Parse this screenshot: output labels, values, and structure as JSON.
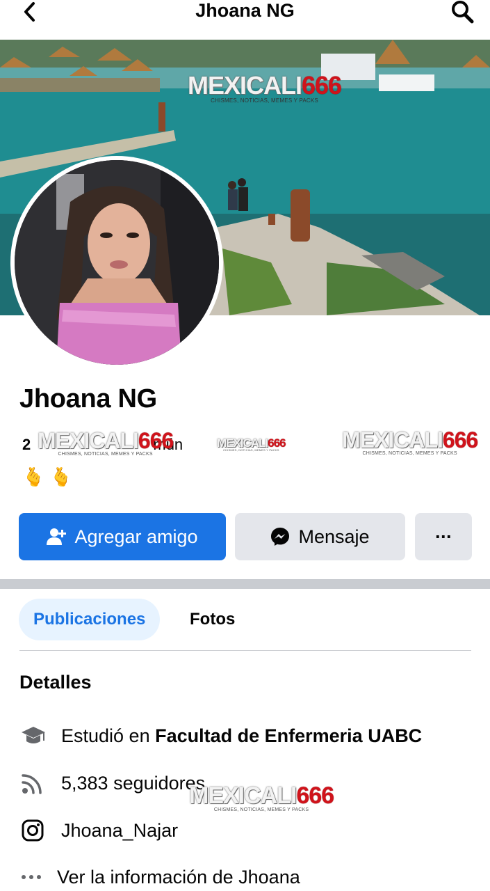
{
  "header": {
    "title": "Jhoana NG",
    "back_icon": "chevron-left-icon",
    "search_icon": "search-icon"
  },
  "watermark": {
    "brand_main": "MEXICALI",
    "brand_num": "666",
    "tagline": "CHISMES, NOTICIAS, MEMES Y PACKS"
  },
  "profile": {
    "name": "Jhoana NG",
    "mutual_prefix": "2",
    "mutual_suffix": "mún",
    "hands": "🫰 🫰"
  },
  "actions": {
    "add_friend": "Agregar amigo",
    "message": "Mensaje",
    "more": "···"
  },
  "tabs": [
    {
      "label": "Publicaciones",
      "active": true
    },
    {
      "label": "Fotos",
      "active": false
    }
  ],
  "details": {
    "title": "Detalles",
    "study_prefix": "Estudió en ",
    "study_place": "Facultad de Enfermeria UABC",
    "followers": "5,383 seguidores",
    "instagram": "Jhoana_Najar",
    "see_more": "Ver la información de Jhoana"
  },
  "colors": {
    "accent": "#1b74e4",
    "secondary_button": "#e4e6eb",
    "active_tab_bg": "#e7f3ff"
  }
}
